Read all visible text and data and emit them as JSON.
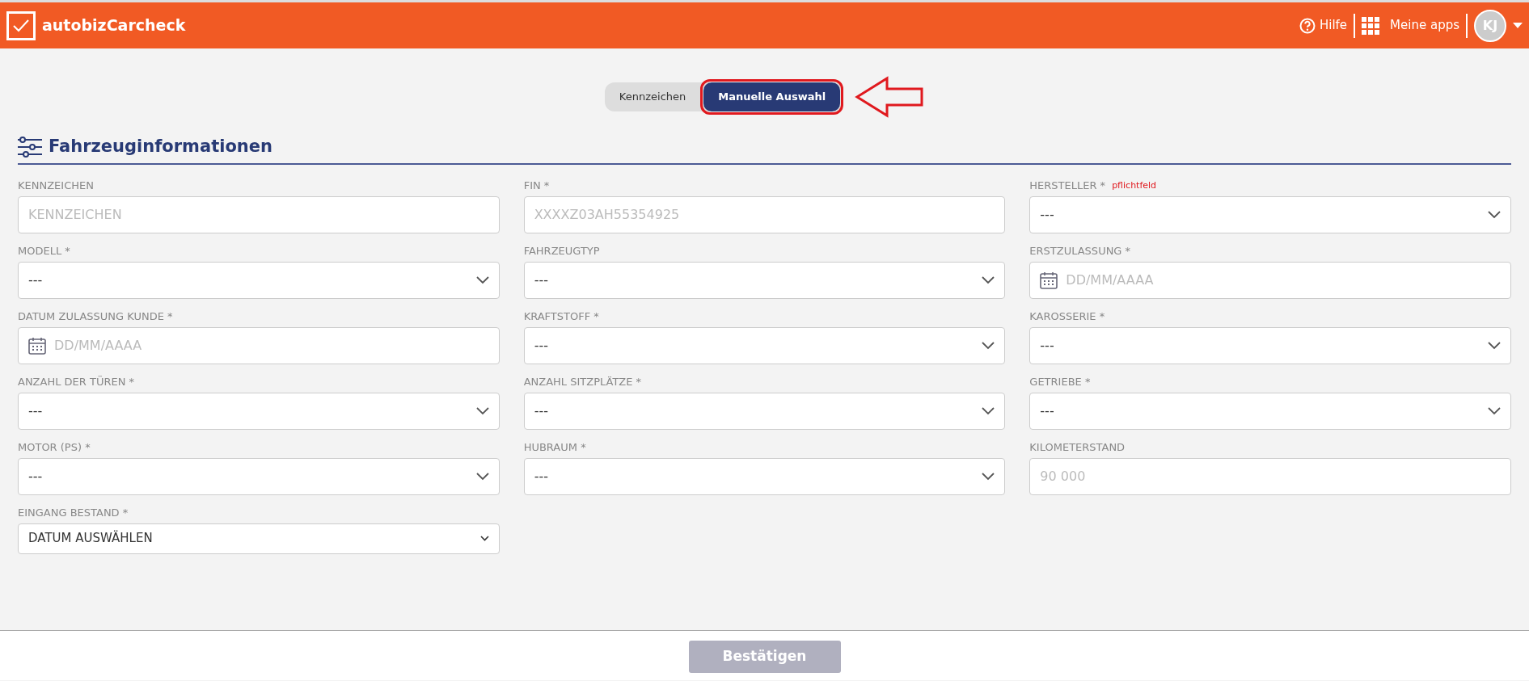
{
  "header": {
    "brand": "autobizCarcheck",
    "help": "Hilfe",
    "apps": "Meine apps",
    "avatar": "KJ"
  },
  "mode_tabs": [
    {
      "label": "Kennzeichen",
      "selected": false
    },
    {
      "label": "Manuelle Auswahl",
      "selected": true
    }
  ],
  "section": {
    "title": "Fahrzeuginformationen"
  },
  "fields": [
    {
      "label": "KENNZEICHEN",
      "kind": "text",
      "placeholder": "KENNZEICHEN"
    },
    {
      "label": "FIN *",
      "kind": "text",
      "placeholder": "XXXXZ03AH55354925"
    },
    {
      "label": "HERSTELLER *",
      "note": "pflichtfeld",
      "kind": "select",
      "value": "---"
    },
    {
      "label": "MODELL *",
      "kind": "select",
      "value": "---"
    },
    {
      "label": "FAHRZEUGTYP",
      "kind": "select",
      "value": "---"
    },
    {
      "label": "ERSTZULASSUNG *",
      "kind": "date",
      "placeholder": "DD/MM/AAAA"
    },
    {
      "label": "DATUM ZULASSUNG KUNDE *",
      "kind": "date",
      "placeholder": "DD/MM/AAAA"
    },
    {
      "label": "KRAFTSTOFF *",
      "kind": "select",
      "value": "---"
    },
    {
      "label": "KAROSSERIE *",
      "kind": "select",
      "value": "---"
    },
    {
      "label": "ANZAHL DER TÜREN *",
      "kind": "select",
      "value": "---"
    },
    {
      "label": "ANZAHL SITZPLÄTZE *",
      "kind": "select",
      "value": "---"
    },
    {
      "label": "GETRIEBE *",
      "kind": "select",
      "value": "---"
    },
    {
      "label": "MOTOR (PS) *",
      "kind": "select",
      "value": "---"
    },
    {
      "label": "HUBRAUM *",
      "kind": "select",
      "value": "---"
    },
    {
      "label": "KILOMETERSTAND",
      "kind": "text",
      "placeholder": "90 000"
    },
    {
      "label": "EINGANG BESTAND *",
      "kind": "native",
      "value": "DATUM AUSWÄHLEN"
    }
  ],
  "footer": {
    "button": "Bestätigen",
    "disabled": true
  }
}
